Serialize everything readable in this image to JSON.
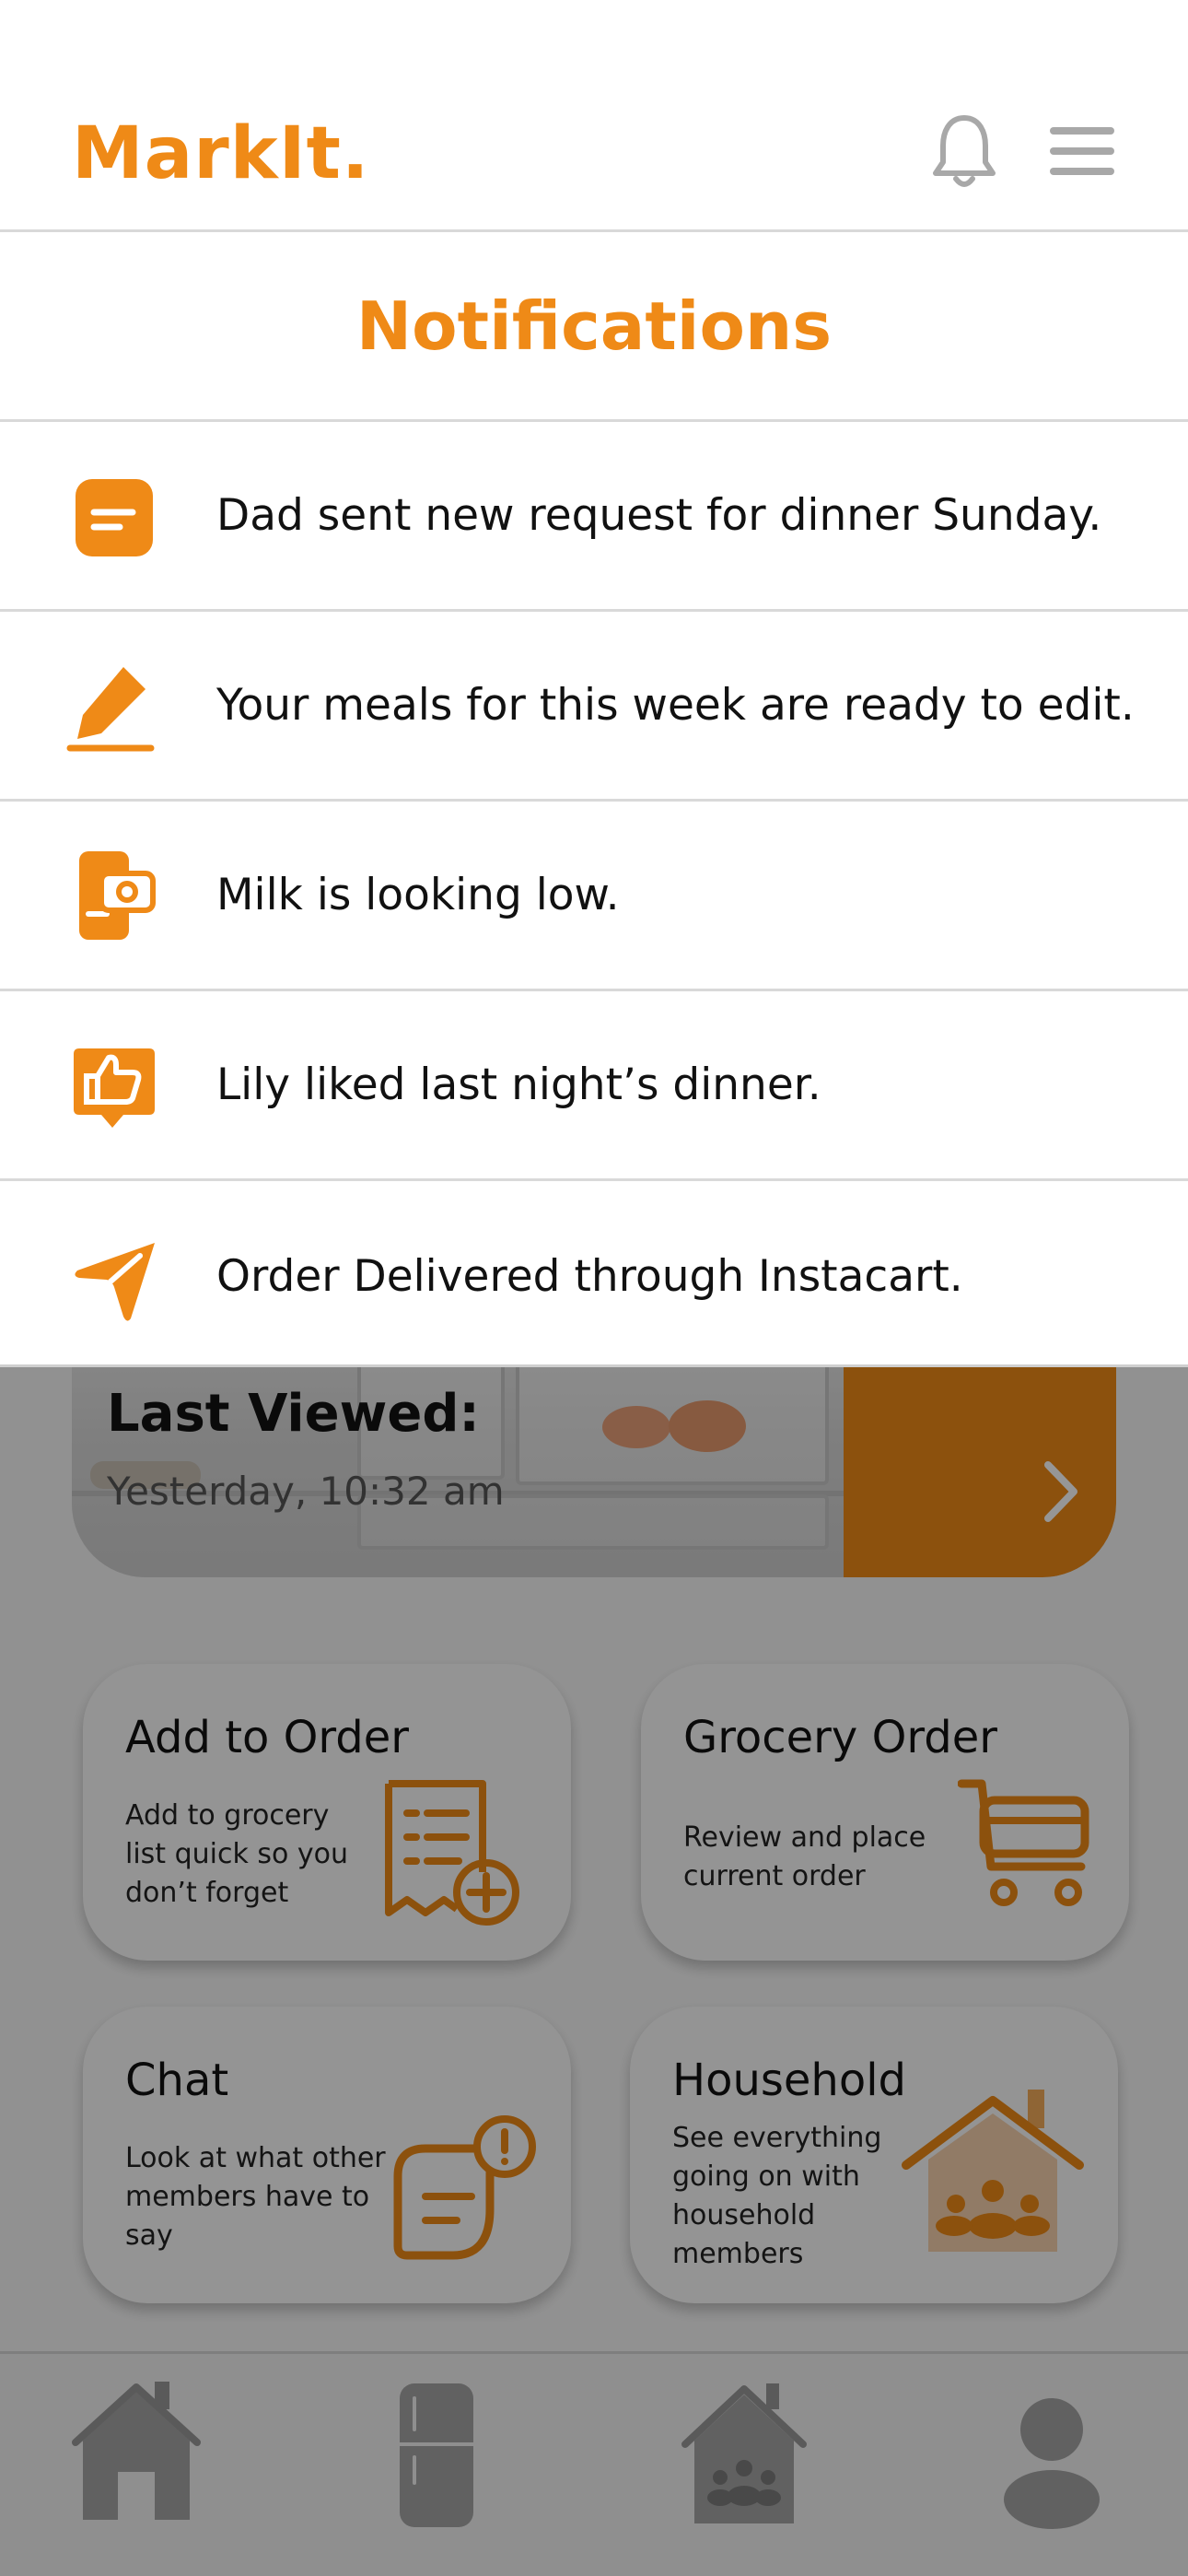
{
  "app": {
    "logo": "MarkIt."
  },
  "header": {
    "bell_icon": "bell-icon",
    "menu_icon": "hamburger-menu-icon"
  },
  "notifications": {
    "title": "Notifications",
    "items": [
      {
        "text": "Dad sent new request for dinner Sunday.",
        "icon": "message-icon"
      },
      {
        "text": "Your meals for this week are ready to edit.",
        "icon": "pencil-icon"
      },
      {
        "text": "Milk is looking low.",
        "icon": "fridge-camera-icon"
      },
      {
        "text": "Lily liked last night’s dinner.",
        "icon": "thumbs-up-icon"
      },
      {
        "text": "Order Delivered through Instacart.",
        "icon": "send-icon"
      }
    ]
  },
  "last_viewed": {
    "title": "Last Viewed:",
    "time": "Yesterday, 10:32 am",
    "arrow_icon": "chevron-right-icon"
  },
  "cards": [
    {
      "title": "Add to Order",
      "description": "Add to grocery list quick so you don’t forget",
      "icon": "receipt-add-icon"
    },
    {
      "title": "Grocery Order",
      "description": "Review and place current order",
      "icon": "cart-icon"
    },
    {
      "title": "Chat",
      "description": "Look at what other members have to say",
      "icon": "chat-alert-icon"
    },
    {
      "title": "Household",
      "description": "See everything going on with household members",
      "icon": "household-icon"
    }
  ],
  "tabbar": {
    "tabs": [
      "home-icon",
      "fridge-icon",
      "household-icon",
      "profile-icon"
    ]
  },
  "colors": {
    "accent": "#ef8a17",
    "overlay": "rgba(0,0,0,0.41)"
  }
}
